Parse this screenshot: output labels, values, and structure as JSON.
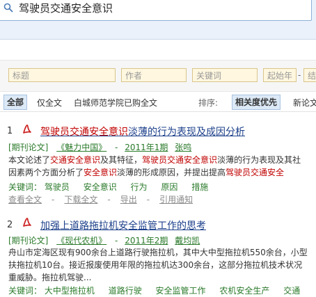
{
  "search": {
    "query": "驾驶员交通安全意识"
  },
  "advanced": {
    "title_placeholder": "标题",
    "author_placeholder": "作者",
    "keyword_placeholder": "关键词",
    "start_year_placeholder": "起始年",
    "dash": "-",
    "end_year_placeholder": "结"
  },
  "filters": {
    "all": "全部",
    "fulltext_only": "仅全文",
    "purchased": "白城师范学院已购全文",
    "sort_label": "排序:",
    "sort_relevance": "相关度优先",
    "sort_newest": "新论文"
  },
  "results": [
    {
      "num": "1",
      "title_hl": "驾驶员交通安全意识",
      "title_rest": "淡薄的行为表现及成因分析",
      "type": "[期刊论文]",
      "journal": "《魅力中国》",
      "dash": "-",
      "issue": "2011年1期",
      "author": "张鸣",
      "abstract_lines": [
        [
          {
            "t": "本文论述了",
            "h": false
          },
          {
            "t": "交通安全意识",
            "h": true
          },
          {
            "t": "及其特征，",
            "h": false
          },
          {
            "t": "驾驶员交通安全意识",
            "h": true
          },
          {
            "t": "淡薄的行为表现及其社",
            "h": false
          }
        ],
        [
          {
            "t": "因素两个方面分析了",
            "h": false
          },
          {
            "t": "安全意识",
            "h": true
          },
          {
            "t": "淡薄的形成原因，并提出提高",
            "h": false
          },
          {
            "t": "驾驶员交通安全",
            "h": true
          }
        ]
      ],
      "keywords_label": "关键词：",
      "keywords": [
        "驾驶员",
        "安全意识",
        "行为",
        "原因",
        "措施"
      ],
      "ops": [
        "查看全文",
        "下载全文",
        "导出",
        "引用通知"
      ]
    },
    {
      "num": "2",
      "title": "加强上道路拖拉机安全监管工作的思考",
      "type": "[期刊论文]",
      "journal": "《现代农机》",
      "dash": "-",
      "issue": "2011年2期",
      "author": "戴均凯",
      "abstract_lines": [
        "舟山市定海区现有900余台上道路行驶拖拉机，其中大中型拖拉机550余台，小型",
        "扶拖拉机10台。接近报废使用年限的拖拉机达300余台，这部分拖拉机技术状况",
        "重威胁。拖拉机驾驶..."
      ],
      "keywords_label": "关键词：",
      "keywords": [
        "大中型拖拉机",
        "道路行驶",
        "安全监管工作",
        "农机安全生产",
        "交通"
      ]
    }
  ],
  "colors": {
    "highlight": "#c00000",
    "link": "#1b3f8a",
    "meta": "#2a7a2a",
    "accent_bg": "#dce9f6"
  }
}
